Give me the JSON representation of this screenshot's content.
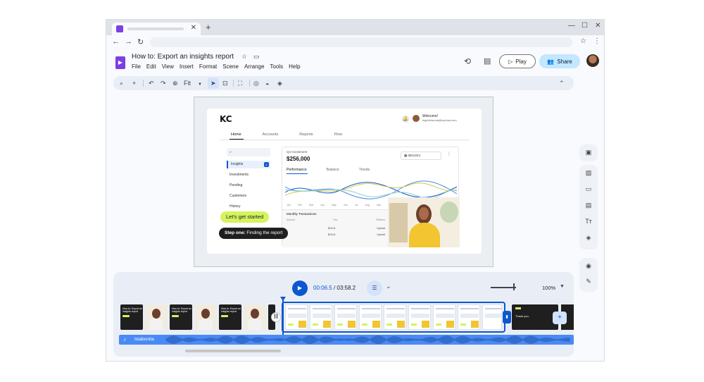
{
  "doc": {
    "title": "How to: Export an insights report"
  },
  "menus": [
    "File",
    "Edit",
    "View",
    "Insert",
    "Format",
    "Scene",
    "Arrange",
    "Tools",
    "Help"
  ],
  "header": {
    "play_label": "Play",
    "share_label": "Share"
  },
  "toolbar": {
    "zoom_label": "Fit"
  },
  "slide": {
    "logo": "KC",
    "welcome": "Welcome!",
    "email": "ingridsharma@cymbal.com",
    "tabs": [
      "Home",
      "Accounts",
      "Reports",
      "Flow"
    ],
    "nav": [
      "Insights",
      "Investments",
      "Pending",
      "Customers",
      "History"
    ],
    "nav_badge": "4",
    "q4_label": "Q4 Investment",
    "amount": "$256,000",
    "date": "08/14/24",
    "panel_tabs": [
      "Performance",
      "Balance",
      "Trends"
    ],
    "months": [
      "Jan",
      "Feb",
      "Mar",
      "Apr",
      "May",
      "Jun",
      "Jul",
      "Aug",
      "Sep",
      "Oct"
    ],
    "transactions_title": "Monthly Transactions",
    "table_head": [
      "Amount",
      "Fee",
      "Platform"
    ],
    "rows": [
      {
        "amount": "",
        "fee": "$15.04",
        "platform": "Cymbal"
      },
      {
        "amount": "",
        "fee": "$15.04",
        "platform": "Cymbal"
      }
    ],
    "pill_green": "Let's get started",
    "pill_dark_bold": "Step one:",
    "pill_dark_rest": " Finding the report"
  },
  "timeline": {
    "current_time": "00:06.5",
    "total_time": "/ 03:58.2",
    "zoom": "100%",
    "clip_text": "How to: Export an insights report",
    "thanks_text": "Thank you.",
    "audio_track": "Islabonita"
  }
}
